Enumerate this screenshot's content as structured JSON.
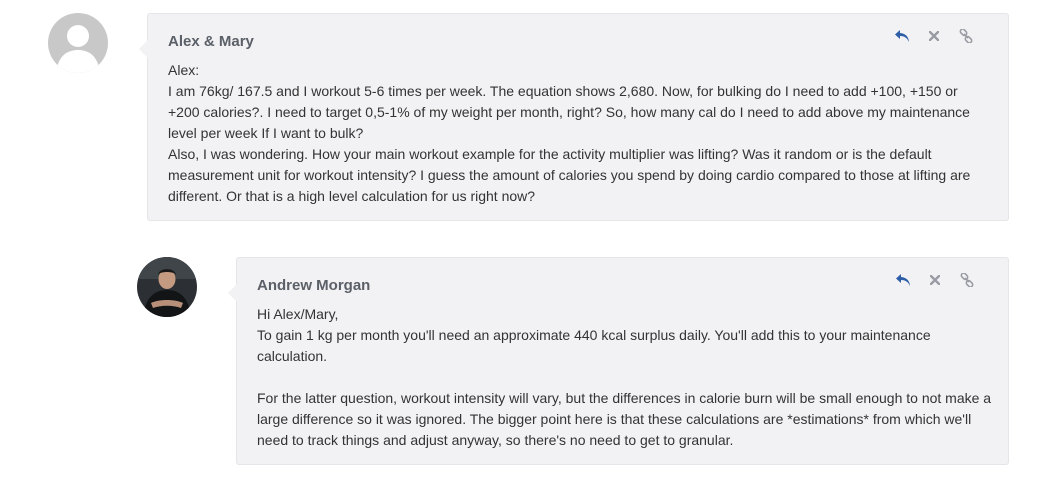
{
  "comments": [
    {
      "author": "Alex & Mary",
      "avatar": "default-avatar-icon",
      "paragraphs": [
        "Alex:",
        "I am 76kg/ 167.5 and I workout 5-6 times per week. The equation shows  2,680. Now, for bulking do I need to add +100, +150 or +200 calories?. I need to target 0,5-1% of my weight per month, right? So, how many cal do I need to add above my maintenance level per week If I want to bulk?",
        "Also, I was wondering. How your main workout example  for the activity multiplier was lifting? Was it random or is the default measurement unit for workout intensity?  I guess the amount of calories you spend by doing cardio compared to those at lifting are different. Or that is a high level calculation for us right now?"
      ]
    },
    {
      "author": "Andrew Morgan",
      "avatar": "user-photo-avatar",
      "paragraphs": [
        "Hi Alex/Mary,",
        "To gain 1 kg per month you'll need an approximate 440 kcal surplus daily. You'll add this to your maintenance calculation.",
        "",
        "For the latter question, workout intensity will vary, but the differences in calorie burn will be small enough to not make a large difference so it was ignored. The bigger point here is that these calculations are *estimations* from which we'll need to track things and adjust anyway, so there's no need to get to granular."
      ]
    }
  ],
  "actions": {
    "reply_icon": "reply-icon",
    "close_icon": "close-icon",
    "link_icon": "link-icon",
    "reply_color": "#2f5ea8",
    "icon_color": "#9a9ca3"
  }
}
